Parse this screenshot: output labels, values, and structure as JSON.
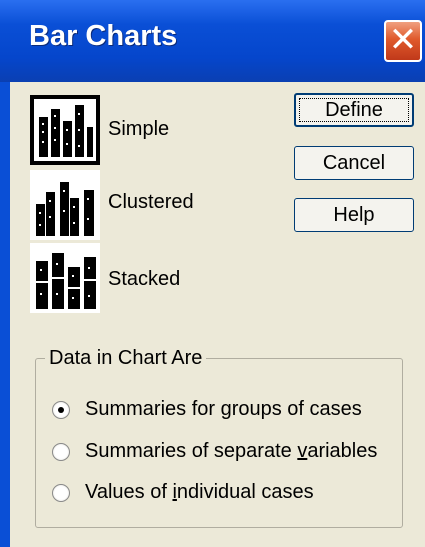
{
  "window": {
    "title": "Bar Charts"
  },
  "chart_types": [
    {
      "label": "Simple",
      "selected": true,
      "icon": "simple-bar-chart-icon"
    },
    {
      "label": "Clustered",
      "selected": false,
      "icon": "clustered-bar-chart-icon"
    },
    {
      "label": "Stacked",
      "selected": false,
      "icon": "stacked-bar-chart-icon"
    }
  ],
  "buttons": {
    "define": "Define",
    "cancel": "Cancel",
    "help": "Help"
  },
  "data_group": {
    "legend": "Data in Chart Are",
    "options": [
      {
        "pre": "Summaries for ",
        "mnemonic": "g",
        "post": "roups of cases",
        "selected": true
      },
      {
        "pre": "Summaries of separate ",
        "mnemonic": "v",
        "post": "ariables",
        "selected": false
      },
      {
        "pre": "Values of ",
        "mnemonic": "i",
        "post": "ndividual cases",
        "selected": false
      }
    ]
  },
  "colors": {
    "titlebar": "#0546cc",
    "close_button": "#e05a2c",
    "dialog_bg": "#ece9d8"
  }
}
